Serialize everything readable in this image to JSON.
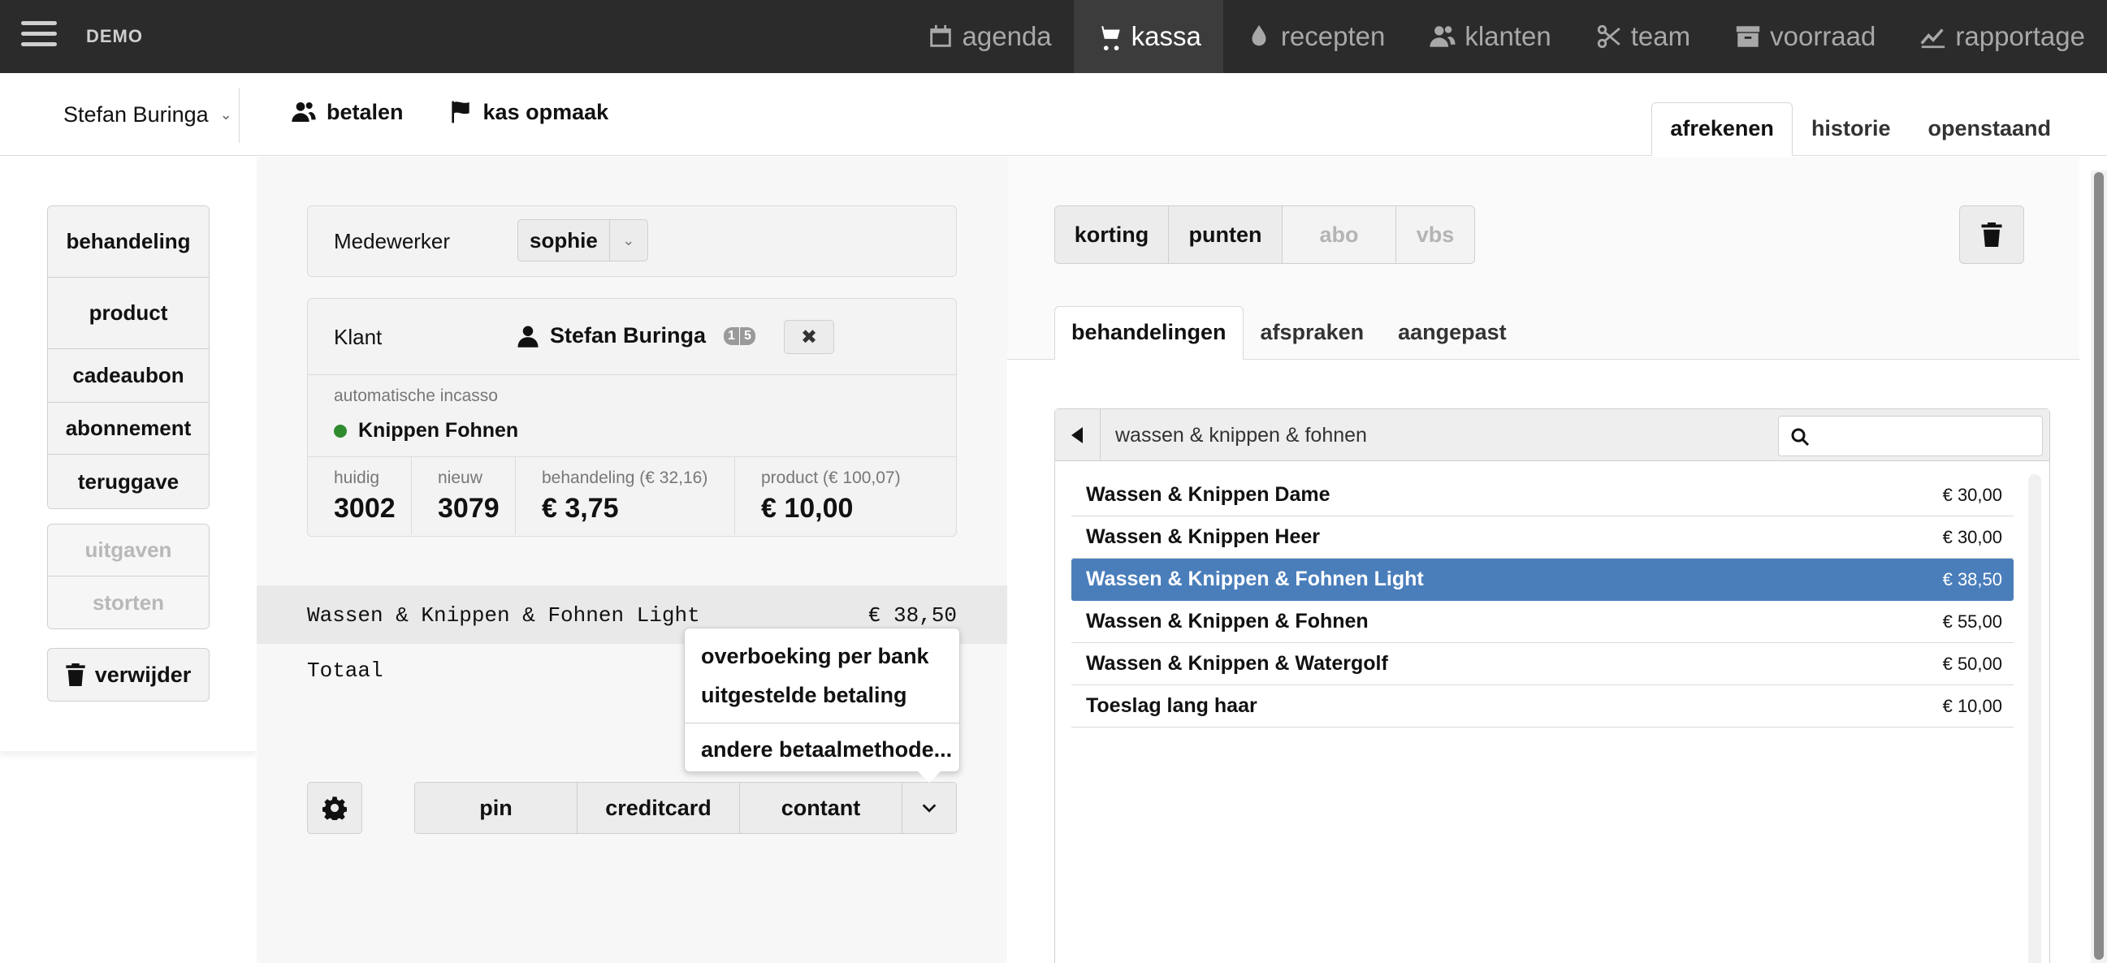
{
  "app": {
    "brand": "DEMO"
  },
  "nav": [
    {
      "label": "agenda",
      "icon": "calendar-icon"
    },
    {
      "label": "kassa",
      "icon": "cart-icon",
      "active": true
    },
    {
      "label": "recepten",
      "icon": "drop-icon"
    },
    {
      "label": "klanten",
      "icon": "users-icon"
    },
    {
      "label": "team",
      "icon": "scissors-icon"
    },
    {
      "label": "voorraad",
      "icon": "archive-icon"
    },
    {
      "label": "rapportage",
      "icon": "chart-line-icon"
    }
  ],
  "subheader": {
    "user": "Stefan Buringa",
    "actions": [
      {
        "label": "betalen",
        "icon": "users-icon"
      },
      {
        "label": "kas opmaak",
        "icon": "flag-icon"
      }
    ],
    "tabs": [
      "afrekenen",
      "historie",
      "openstaand"
    ],
    "active_tab": "afrekenen"
  },
  "left": {
    "group1": [
      "behandeling",
      "product",
      "cadeaubon",
      "abonnement",
      "teruggave"
    ],
    "group2": [
      "uitgaven",
      "storten"
    ],
    "delete_label": "verwijder"
  },
  "middle": {
    "medewerker_label": "Medewerker",
    "medewerker_value": "sophie",
    "klant_label": "Klant",
    "klant_name": "Stefan Buringa",
    "klant_badge": [
      "1",
      "5"
    ],
    "incasso_label": "automatische incasso",
    "incasso_value": "Knippen Fohnen",
    "stats": [
      {
        "label": "huidig",
        "value": "3002"
      },
      {
        "label": "nieuw",
        "value": "3079"
      },
      {
        "label": "behandeling (€ 32,16)",
        "value": "€ 3,75"
      },
      {
        "label": "product (€ 100,07)",
        "value": "€ 10,00"
      }
    ],
    "line_item": {
      "name": "Wassen & Knippen & Fohnen Light",
      "price": "€ 38,50"
    },
    "totaal_label": "Totaal",
    "pay_buttons": [
      "pin",
      "creditcard",
      "contant"
    ],
    "dropdown": [
      "overboeking per bank",
      "uitgestelde betaling",
      "andere betaalmethode..."
    ]
  },
  "right": {
    "modifiers": [
      {
        "label": "korting",
        "enabled": true
      },
      {
        "label": "punten",
        "enabled": true
      },
      {
        "label": "abo",
        "enabled": false
      },
      {
        "label": "vbs",
        "enabled": false
      }
    ],
    "tabs": [
      "behandelingen",
      "afspraken",
      "aangepast"
    ],
    "active_tab": "behandelingen",
    "breadcrumb": "wassen & knippen & fohnen",
    "search_placeholder": "",
    "items": [
      {
        "name": "Wassen & Knippen Dame",
        "price": "€ 30,00"
      },
      {
        "name": "Wassen & Knippen Heer",
        "price": "€ 30,00"
      },
      {
        "name": "Wassen & Knippen & Fohnen Light",
        "price": "€ 38,50",
        "selected": true
      },
      {
        "name": "Wassen & Knippen & Fohnen",
        "price": "€ 55,00"
      },
      {
        "name": "Wassen & Knippen & Watergolf",
        "price": "€ 50,00"
      },
      {
        "name": "Toeslag lang haar",
        "price": "€ 10,00"
      }
    ]
  },
  "colors": {
    "topbar": "#2b2b2b",
    "selected_row": "#4a7ebb",
    "status_dot": "#2e8b2e"
  }
}
